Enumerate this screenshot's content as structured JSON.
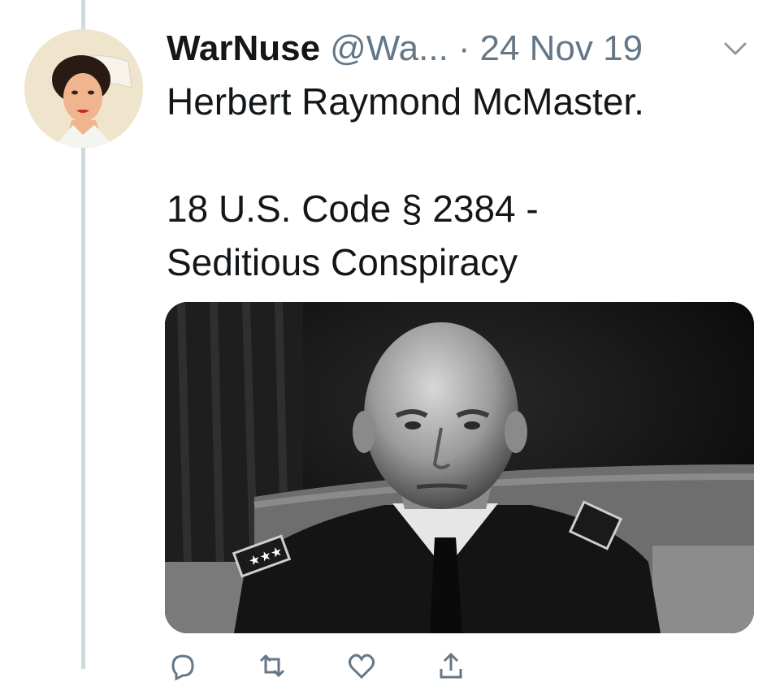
{
  "tweet": {
    "display_name": "WarNuse",
    "handle": "@Wa...",
    "separator": "·",
    "date": "24 Nov 19",
    "menu_icon": "chevron-down-icon",
    "text_line_1": "Herbert Raymond McMaster.",
    "text_line_2": "18 U.S. Code § 2384 -",
    "text_line_3": "Seditious Conspiracy",
    "avatar_icon": "avatar-pinup-nurse",
    "media": "photo-general-in-uniform-black-and-white"
  },
  "actions": {
    "reply_icon": "reply-icon",
    "retweet_icon": "retweet-icon",
    "like_icon": "like-icon",
    "share_icon": "share-icon"
  },
  "colors": {
    "text": "#14171a",
    "secondary": "#657786",
    "thread_line": "#cfd9de"
  }
}
